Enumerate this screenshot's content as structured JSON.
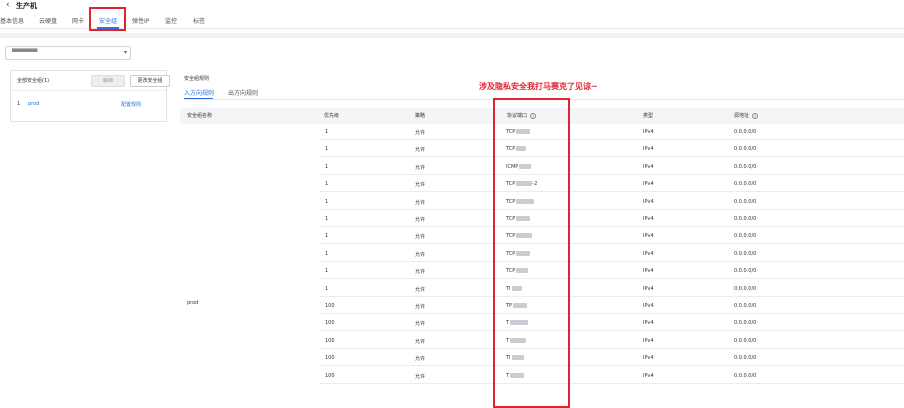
{
  "header": {
    "back_icon": "‹",
    "title": "生产机"
  },
  "tabs": [
    {
      "label": "基本信息"
    },
    {
      "label": "云硬盘"
    },
    {
      "label": "网卡"
    },
    {
      "label": "安全组",
      "active": true
    },
    {
      "label": "弹性IP"
    },
    {
      "label": "监控"
    },
    {
      "label": "标签"
    }
  ],
  "vpc_select": {
    "value": "▀▀ ▀ ▀▀ ▀"
  },
  "left_panel": {
    "title": "全部安全组(1)",
    "unbind_label": "解绑",
    "change_label": "更改安全组",
    "item_index": "1",
    "item_name": "prod",
    "config_label": "配置规则"
  },
  "rules_panel": {
    "title": "安全组规则",
    "tab_inbound": "入方向规则",
    "tab_outbound": "出方向规则"
  },
  "annotation": "涉及隐私安全我打马赛克了见谅~",
  "table": {
    "headers": {
      "sg_name": "安全组名称",
      "priority": "优先级",
      "policy": "策略",
      "protocol_port": "协议端口",
      "type": "类型",
      "source": "源地址"
    },
    "sg_name_value": "prod",
    "rows": [
      {
        "priority": "1",
        "policy": "允许",
        "proto": "TCP",
        "suffix": "",
        "type": "IPv4",
        "source": "0.0.0.0/0"
      },
      {
        "priority": "1",
        "policy": "允许",
        "proto": "TCP",
        "suffix": "",
        "type": "IPv4",
        "source": "0.0.0.0/0"
      },
      {
        "priority": "1",
        "policy": "允许",
        "proto": "ICMP",
        "suffix": "",
        "type": "IPv4",
        "source": "0.0.0.0/0"
      },
      {
        "priority": "1",
        "policy": "允许",
        "proto": "TCP",
        "suffix": "-2",
        "type": "IPv4",
        "source": "0.0.0.0/0"
      },
      {
        "priority": "1",
        "policy": "允许",
        "proto": "TCP",
        "suffix": "",
        "type": "IPv4",
        "source": "0.0.0.0/0"
      },
      {
        "priority": "1",
        "policy": "允许",
        "proto": "TCP",
        "suffix": "",
        "type": "IPv4",
        "source": "0.0.0.0/0"
      },
      {
        "priority": "1",
        "policy": "允许",
        "proto": "TCP",
        "suffix": "",
        "type": "IPv4",
        "source": "0.0.0.0/0"
      },
      {
        "priority": "1",
        "policy": "允许",
        "proto": "TCP",
        "suffix": "",
        "type": "IPv4",
        "source": "0.0.0.0/0"
      },
      {
        "priority": "1",
        "policy": "允许",
        "proto": "TCP",
        "suffix": "",
        "type": "IPv4",
        "source": "0.0.0.0/0"
      },
      {
        "priority": "1",
        "policy": "允许",
        "proto": "TI",
        "suffix": "",
        "type": "IPv4",
        "source": "0.0.0.0/0"
      },
      {
        "priority": "100",
        "policy": "允许",
        "proto": "TP",
        "suffix": "",
        "type": "IPv4",
        "source": "0.0.0.0/0"
      },
      {
        "priority": "100",
        "policy": "允许",
        "proto": "T",
        "suffix": "",
        "type": "IPv4",
        "source": "0.0.0.0/0"
      },
      {
        "priority": "100",
        "policy": "允许",
        "proto": "T",
        "suffix": "",
        "type": "IPv4",
        "source": "0.0.0.0/0"
      },
      {
        "priority": "100",
        "policy": "允许",
        "proto": "TI",
        "suffix": "",
        "type": "IPv4",
        "source": "0.0.0.0/0"
      },
      {
        "priority": "100",
        "policy": "允许",
        "proto": "T",
        "suffix": "",
        "type": "IPv4",
        "source": "0.0.0.0/0"
      }
    ]
  },
  "colors": {
    "accent": "#2d6fe0",
    "annotation_red": "#e0232f"
  }
}
